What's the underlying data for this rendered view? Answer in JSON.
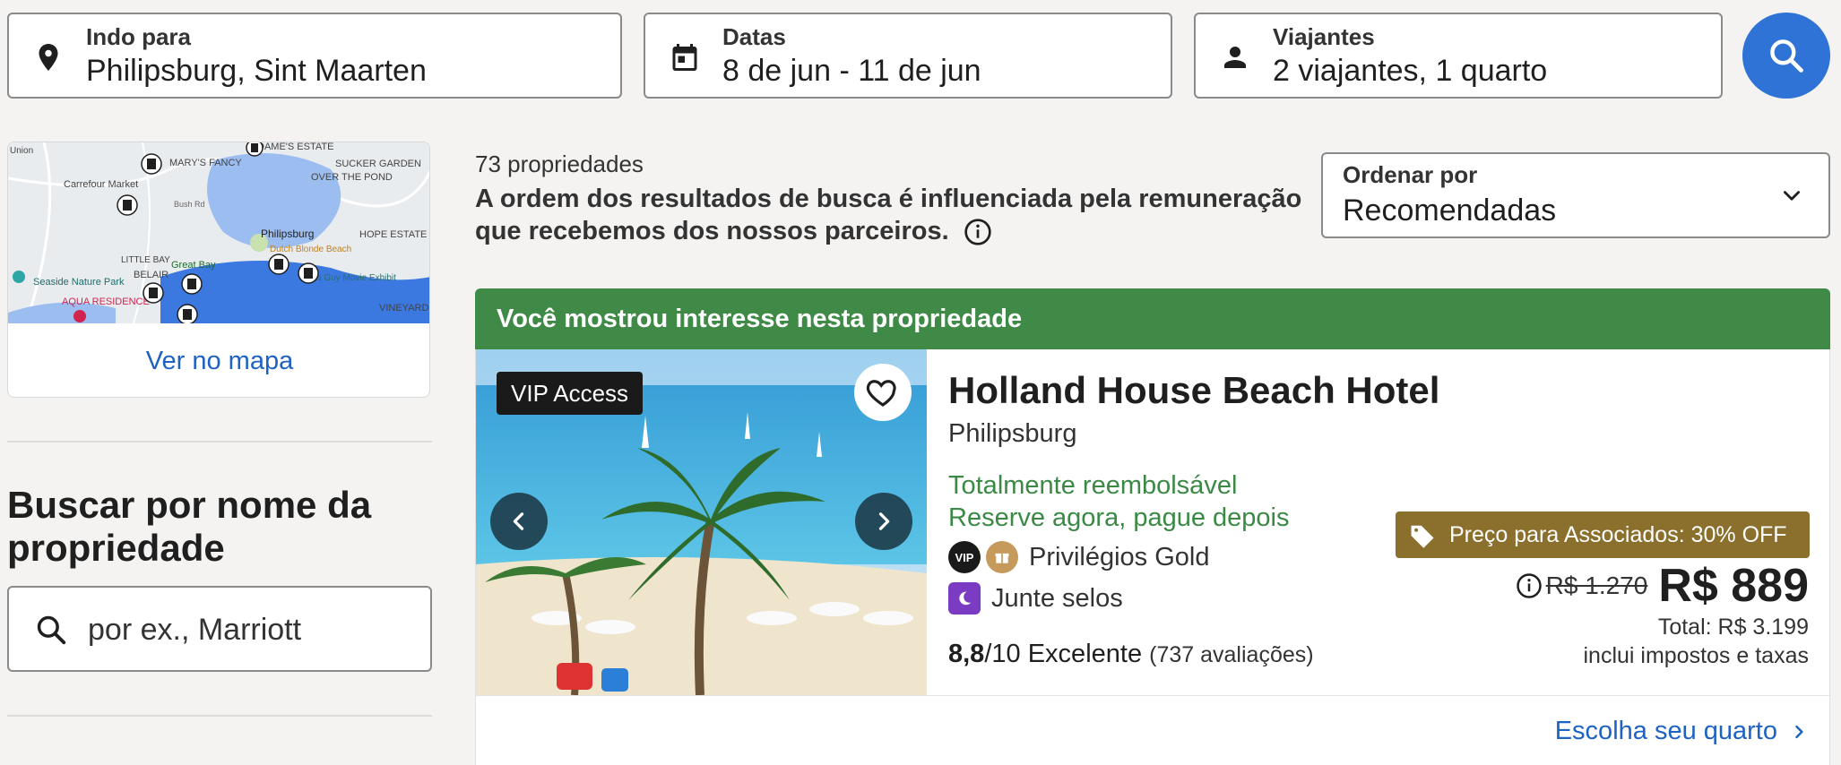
{
  "search": {
    "destination": {
      "label": "Indo para",
      "value": "Philipsburg, Sint Maarten"
    },
    "dates": {
      "label": "Datas",
      "value": "8 de jun - 11 de jun"
    },
    "travelers": {
      "label": "Viajantes",
      "value": "2 viajantes, 1 quarto"
    }
  },
  "map": {
    "link": "Ver no mapa",
    "labels": {
      "marys_fancy": "MARY'S FANCY",
      "dames_estate": "DAME'S ESTATE",
      "sucker_garden": "SUCKER GARDEN",
      "over_the_pond": "OVER THE POND",
      "carrefour": "Carrefour Market",
      "bush_rd": "Bush Rd",
      "philipsburg": "Philipsburg",
      "hope_estate": "HOPE ESTATE",
      "dutch_blonde": "Dutch Blonde Beach",
      "little_bay": "LITTLE BAY",
      "belair": "BELAIR",
      "great_bay": "Great Bay",
      "seaside": "Seaside Nature Park",
      "aqua": "AQUA RESIDENCE",
      "movie": "a Guy Movie Exhibit",
      "vineyard": "VINEYARD",
      "union": "Union"
    }
  },
  "filter": {
    "title": "Buscar por nome da propriedade",
    "placeholder": "por ex., Marriott"
  },
  "results": {
    "count": "73 propriedades",
    "disclaimer": "A ordem dos resultados de busca é influenciada pela remuneração que recebemos dos nossos parceiros."
  },
  "sort": {
    "label": "Ordenar por",
    "value": "Recomendadas"
  },
  "listing": {
    "banner": "Você mostrou interesse nesta propriedade",
    "vip_badge": "VIP Access",
    "name": "Holland House Beach Hotel",
    "location": "Philipsburg",
    "refundable": "Totalmente reembolsável",
    "pay_later": "Reserve agora, pague depois",
    "perk_gold": "Privilégios Gold",
    "perk_stamps": "Junte selos",
    "rating_score": "8,8",
    "rating_scale": "/10",
    "rating_word": "Excelente",
    "rating_count": "(737 avaliações)",
    "deal": "Preço para Associados: 30% OFF",
    "old_price": "R$ 1.270",
    "price": "R$ 889",
    "total": "Total: R$ 3.199",
    "taxes": "inclui impostos e taxas",
    "cta": "Escolha seu quarto"
  },
  "colors": {
    "accent_blue": "#2f73d6",
    "link_blue": "#1e63c3",
    "banner_green": "#3f8a46",
    "refund_green": "#3a8a45",
    "deal_gold": "#8b6f2c"
  }
}
